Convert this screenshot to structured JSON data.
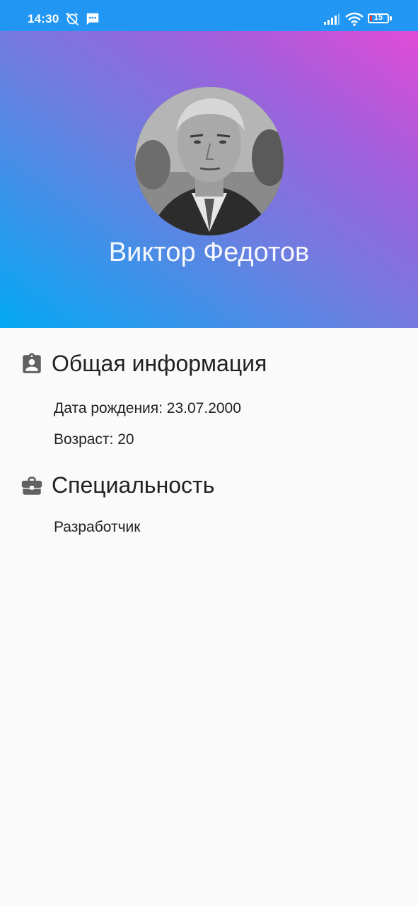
{
  "status_bar": {
    "time": "14:30",
    "battery_level": "15",
    "icons": [
      "alarm-off-icon",
      "message-icon",
      "signal-icon",
      "wifi-icon",
      "battery-icon"
    ]
  },
  "profile": {
    "name": "Виктор Федотов",
    "gradient_colors": [
      "#03a9f4",
      "#a35edb",
      "#e14bd6"
    ]
  },
  "general_info": {
    "title": "Общая информация",
    "birth_date": "Дата рождения: 23.07.2000",
    "age": "Возраст: 20",
    "icon": "contact-badge-icon"
  },
  "specialty": {
    "title": "Специальность",
    "value": "Разработчик",
    "icon": "briefcase-icon"
  }
}
